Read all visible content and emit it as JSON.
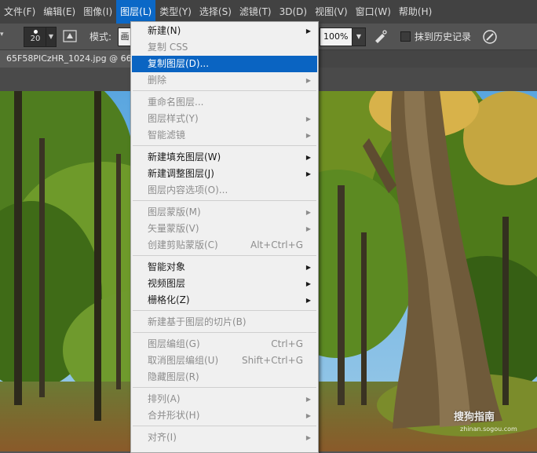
{
  "menubar": {
    "items": [
      {
        "label": "文件(F)",
        "active": false
      },
      {
        "label": "编辑(E)",
        "active": false
      },
      {
        "label": "图像(I)",
        "active": false
      },
      {
        "label": "图层(L)",
        "active": true
      },
      {
        "label": "类型(Y)",
        "active": false
      },
      {
        "label": "选择(S)",
        "active": false
      },
      {
        "label": "滤镜(T)",
        "active": false
      },
      {
        "label": "3D(D)",
        "active": false
      },
      {
        "label": "视图(V)",
        "active": false
      },
      {
        "label": "窗口(W)",
        "active": false
      },
      {
        "label": "帮助(H)",
        "active": false
      }
    ]
  },
  "options": {
    "brush_size": "20",
    "mode_label": "模式:",
    "mode_value": "画",
    "flow_value": "100%",
    "history_label": "抹到历史记录"
  },
  "document": {
    "tab_title": "65F58PICzHR_1024.jpg @ 66"
  },
  "layer_menu": {
    "items": [
      {
        "label": "新建(N)",
        "shortcut": "",
        "submenu": true,
        "disabled": false,
        "highlight": false,
        "sep_before": false
      },
      {
        "label": "复制 CSS",
        "shortcut": "",
        "submenu": false,
        "disabled": true,
        "highlight": false,
        "sep_before": false
      },
      {
        "label": "复制图层(D)...",
        "shortcut": "",
        "submenu": false,
        "disabled": false,
        "highlight": true,
        "sep_before": false
      },
      {
        "label": "删除",
        "shortcut": "",
        "submenu": true,
        "disabled": true,
        "highlight": false,
        "sep_before": false
      },
      {
        "label": "重命名图层...",
        "shortcut": "",
        "submenu": false,
        "disabled": true,
        "highlight": false,
        "sep_before": true
      },
      {
        "label": "图层样式(Y)",
        "shortcut": "",
        "submenu": true,
        "disabled": true,
        "highlight": false,
        "sep_before": false
      },
      {
        "label": "智能滤镜",
        "shortcut": "",
        "submenu": true,
        "disabled": true,
        "highlight": false,
        "sep_before": false
      },
      {
        "label": "新建填充图层(W)",
        "shortcut": "",
        "submenu": true,
        "disabled": false,
        "highlight": false,
        "sep_before": true
      },
      {
        "label": "新建调整图层(J)",
        "shortcut": "",
        "submenu": true,
        "disabled": false,
        "highlight": false,
        "sep_before": false
      },
      {
        "label": "图层内容选项(O)...",
        "shortcut": "",
        "submenu": false,
        "disabled": true,
        "highlight": false,
        "sep_before": false
      },
      {
        "label": "图层蒙版(M)",
        "shortcut": "",
        "submenu": true,
        "disabled": true,
        "highlight": false,
        "sep_before": true
      },
      {
        "label": "矢量蒙版(V)",
        "shortcut": "",
        "submenu": true,
        "disabled": true,
        "highlight": false,
        "sep_before": false
      },
      {
        "label": "创建剪贴蒙版(C)",
        "shortcut": "Alt+Ctrl+G",
        "submenu": false,
        "disabled": true,
        "highlight": false,
        "sep_before": false
      },
      {
        "label": "智能对象",
        "shortcut": "",
        "submenu": true,
        "disabled": false,
        "highlight": false,
        "sep_before": true
      },
      {
        "label": "视频图层",
        "shortcut": "",
        "submenu": true,
        "disabled": false,
        "highlight": false,
        "sep_before": false
      },
      {
        "label": "栅格化(Z)",
        "shortcut": "",
        "submenu": true,
        "disabled": false,
        "highlight": false,
        "sep_before": false
      },
      {
        "label": "新建基于图层的切片(B)",
        "shortcut": "",
        "submenu": false,
        "disabled": true,
        "highlight": false,
        "sep_before": true
      },
      {
        "label": "图层编组(G)",
        "shortcut": "Ctrl+G",
        "submenu": false,
        "disabled": true,
        "highlight": false,
        "sep_before": true
      },
      {
        "label": "取消图层编组(U)",
        "shortcut": "Shift+Ctrl+G",
        "submenu": false,
        "disabled": true,
        "highlight": false,
        "sep_before": false
      },
      {
        "label": "隐藏图层(R)",
        "shortcut": "",
        "submenu": false,
        "disabled": true,
        "highlight": false,
        "sep_before": false
      },
      {
        "label": "排列(A)",
        "shortcut": "",
        "submenu": true,
        "disabled": true,
        "highlight": false,
        "sep_before": true
      },
      {
        "label": "合并形状(H)",
        "shortcut": "",
        "submenu": true,
        "disabled": true,
        "highlight": false,
        "sep_before": false
      },
      {
        "label": "对齐(I)",
        "shortcut": "",
        "submenu": true,
        "disabled": true,
        "highlight": false,
        "sep_before": true
      }
    ]
  },
  "watermark": {
    "text": "搜狗指南",
    "sub": "zhinan.sogou.com"
  },
  "icons": {
    "submenu_arrow": "triangle-right-icon",
    "dropdown_caret": "caret-down-icon"
  },
  "colors": {
    "menu_highlight": "#0a64c2",
    "menubar_active": "#0b68c7"
  }
}
